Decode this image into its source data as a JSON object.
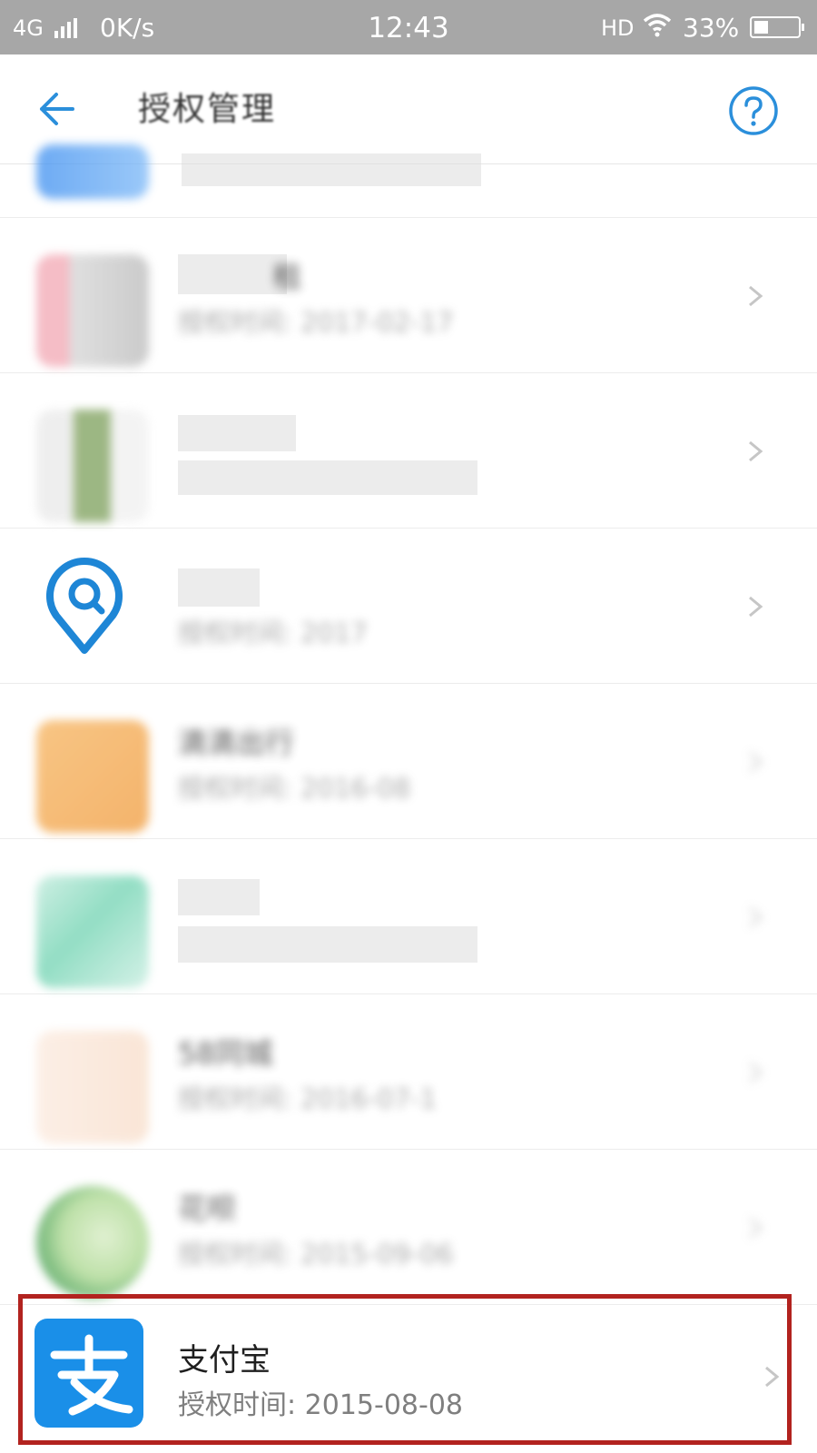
{
  "status_bar": {
    "network": "4G",
    "speed": "0K/s",
    "time": "12:43",
    "hd": "HD",
    "battery": "33%",
    "battery_level": 0.33
  },
  "header": {
    "title": "授权管理",
    "back_icon": "back-arrow-icon",
    "help_icon": "question-circle-icon",
    "accent_color": "#2b8fdb"
  },
  "list": {
    "items": [
      {
        "name": "",
        "time": ""
      },
      {
        "name": "租",
        "time": "授权时间: 2017-02-17"
      },
      {
        "name": "",
        "time": ""
      },
      {
        "name": "",
        "time": "授权时间: 2017"
      },
      {
        "name": "滴滴出行",
        "time": "授权时间: 2016-08"
      },
      {
        "name": "",
        "time": ""
      },
      {
        "name": "58同城",
        "time": "授权时间: 2016-07-1"
      },
      {
        "name": "花呗",
        "time": "授权时间: 2015-09-06"
      }
    ],
    "highlighted": {
      "name": "支付宝",
      "time": "授权时间: 2015-08-08",
      "icon": "alipay-icon",
      "icon_glyph": "支",
      "highlight_color": "#b2231f"
    }
  }
}
